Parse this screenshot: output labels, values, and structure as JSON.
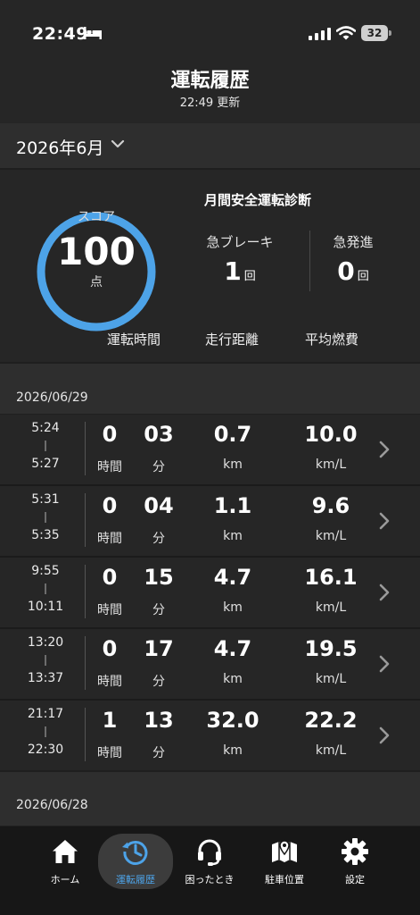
{
  "status": {
    "time": "22:49",
    "battery": "32"
  },
  "header": {
    "title": "運転履歴",
    "updated": "22:49 更新"
  },
  "month": {
    "label": "2026年6月"
  },
  "summary": {
    "score_caption": "スコア",
    "score": "100",
    "score_unit": "点",
    "score_fraction": 1.0,
    "title": "月間安全運転診断",
    "hard_brake_label": "急ブレーキ",
    "hard_brake_value": "1",
    "hard_brake_unit": "回",
    "hard_start_label": "急発進",
    "hard_start_value": "0",
    "hard_start_unit": "回",
    "tabs": [
      "運転時間",
      "走行距離",
      "平均燃費"
    ]
  },
  "units": {
    "hours": "時間",
    "minutes": "分",
    "distance": "km",
    "efficiency": "km/L"
  },
  "days": [
    {
      "date": "2026/06/29",
      "trips": [
        {
          "start": "5:24",
          "end": "5:27",
          "hours": "0",
          "minutes": "03",
          "distance": "0.7",
          "efficiency": "10.0"
        },
        {
          "start": "5:31",
          "end": "5:35",
          "hours": "0",
          "minutes": "04",
          "distance": "1.1",
          "efficiency": "9.6"
        },
        {
          "start": "9:55",
          "end": "10:11",
          "hours": "0",
          "minutes": "15",
          "distance": "4.7",
          "efficiency": "16.1"
        },
        {
          "start": "13:20",
          "end": "13:37",
          "hours": "0",
          "minutes": "17",
          "distance": "4.7",
          "efficiency": "19.5"
        },
        {
          "start": "21:17",
          "end": "22:30",
          "hours": "1",
          "minutes": "13",
          "distance": "32.0",
          "efficiency": "22.2"
        }
      ]
    },
    {
      "date": "2026/06/28",
      "trips": []
    }
  ],
  "nav": [
    {
      "label": "ホーム",
      "icon": "home-icon"
    },
    {
      "label": "運転履歴",
      "icon": "history-icon",
      "active": true
    },
    {
      "label": "困ったとき",
      "icon": "headset-icon"
    },
    {
      "label": "駐車位置",
      "icon": "map-icon"
    },
    {
      "label": "設定",
      "icon": "gear-icon"
    }
  ],
  "colors": {
    "accent": "#4da3e8",
    "background": "#1f1f1f",
    "panel": "#262626"
  }
}
